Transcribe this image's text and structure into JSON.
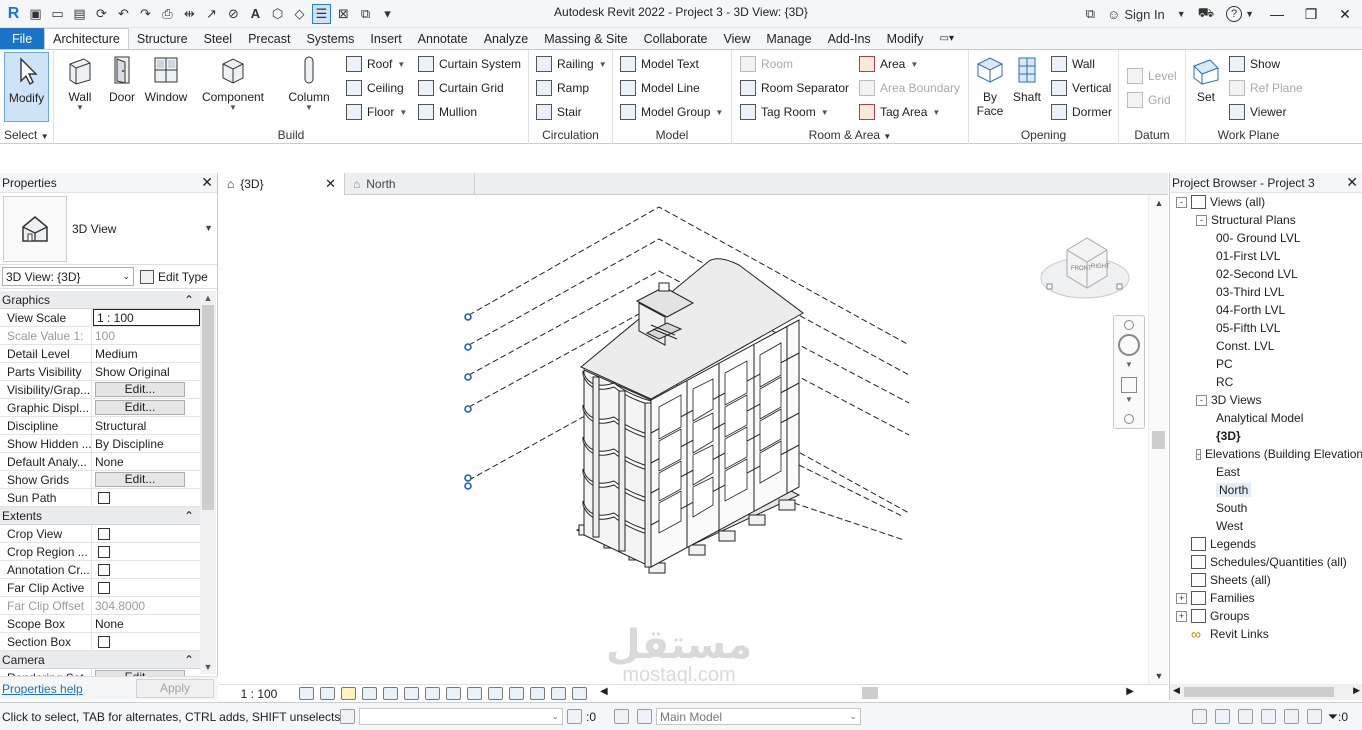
{
  "window": {
    "title": "Autodesk Revit 2022 - Project 3 - 3D View: {3D}",
    "sign_in": "Sign In",
    "help_icon": "?"
  },
  "tabs": [
    "File",
    "Architecture",
    "Structure",
    "Steel",
    "Precast",
    "Systems",
    "Insert",
    "Annotate",
    "Analyze",
    "Massing & Site",
    "Collaborate",
    "View",
    "Manage",
    "Add-Ins",
    "Modify"
  ],
  "active_tab": "Architecture",
  "ribbon": {
    "select": {
      "modify": "Modify",
      "label": "Select"
    },
    "build": {
      "label": "Build",
      "big": [
        "Wall",
        "Door",
        "Window",
        "Component",
        "Column"
      ],
      "small": [
        "Roof",
        "Ceiling",
        "Floor",
        "Curtain System",
        "Curtain Grid",
        "Mullion"
      ]
    },
    "circulation": {
      "label": "Circulation",
      "items": [
        "Railing",
        "Ramp",
        "Stair"
      ]
    },
    "model": {
      "label": "Model",
      "items": [
        "Model Text",
        "Model Line",
        "Model Group"
      ]
    },
    "room_area": {
      "label": "Room & Area",
      "items": [
        "Room",
        "Room Separator",
        "Tag Room",
        "Area",
        "Area Boundary",
        "Tag Area"
      ]
    },
    "opening": {
      "label": "Opening",
      "big": [
        "By Face",
        "Shaft"
      ],
      "items": [
        "Wall",
        "Vertical",
        "Dormer"
      ]
    },
    "datum": {
      "label": "Datum",
      "items": [
        "Level",
        "Grid"
      ]
    },
    "work_plane": {
      "label": "Work Plane",
      "set": "Set",
      "items": [
        "Show",
        "Ref  Plane",
        "Viewer"
      ]
    }
  },
  "properties": {
    "title": "Properties",
    "type_name": "3D View",
    "instance": "3D View: {3D}",
    "edit_type": "Edit Type",
    "sections": [
      {
        "name": "Graphics",
        "rows": [
          {
            "k": "View Scale",
            "v": "1 : 100",
            "style": "boxed"
          },
          {
            "k": "Scale Value    1:",
            "v": "100",
            "style": "gray"
          },
          {
            "k": "Detail Level",
            "v": "Medium"
          },
          {
            "k": "Parts Visibility",
            "v": "Show Original"
          },
          {
            "k": "Visibility/Grap...",
            "v": "Edit...",
            "style": "button"
          },
          {
            "k": "Graphic Displ...",
            "v": "Edit...",
            "style": "button"
          },
          {
            "k": "Discipline",
            "v": "Structural"
          },
          {
            "k": "Show Hidden ...",
            "v": "By Discipline"
          },
          {
            "k": "Default Analy...",
            "v": "None"
          },
          {
            "k": "Show Grids",
            "v": "Edit...",
            "style": "button"
          },
          {
            "k": "Sun Path",
            "v": "",
            "style": "check"
          }
        ]
      },
      {
        "name": "Extents",
        "rows": [
          {
            "k": "Crop View",
            "v": "",
            "style": "check"
          },
          {
            "k": "Crop Region ...",
            "v": "",
            "style": "check"
          },
          {
            "k": "Annotation Cr...",
            "v": "",
            "style": "check"
          },
          {
            "k": "Far Clip Active",
            "v": "",
            "style": "check"
          },
          {
            "k": "Far Clip Offset",
            "v": "304.8000",
            "style": "gray"
          },
          {
            "k": "Scope Box",
            "v": "None"
          },
          {
            "k": "Section Box",
            "v": "",
            "style": "check"
          }
        ]
      },
      {
        "name": "Camera",
        "rows": [
          {
            "k": "Rendering Set...",
            "v": "Edit...",
            "style": "button"
          }
        ]
      }
    ],
    "help": "Properties help",
    "apply": "Apply"
  },
  "view_tabs": [
    {
      "label": "{3D}",
      "active": true
    },
    {
      "label": "North",
      "active": false
    }
  ],
  "view_cube": {
    "front": "FRONT",
    "right": "RIGHT"
  },
  "view_scale": "1 : 100",
  "browser": {
    "title": "Project Browser - Project 3",
    "nodes": [
      {
        "label": "Views (all)",
        "depth": 0,
        "toggle": "-",
        "icon": true
      },
      {
        "label": "Structural Plans",
        "depth": 1,
        "toggle": "-"
      },
      {
        "label": "00- Ground LVL",
        "depth": 2
      },
      {
        "label": "01-First LVL",
        "depth": 2
      },
      {
        "label": "02-Second LVL",
        "depth": 2
      },
      {
        "label": "03-Third LVL",
        "depth": 2
      },
      {
        "label": "04-Forth LVL",
        "depth": 2
      },
      {
        "label": "05-Fifth LVL",
        "depth": 2
      },
      {
        "label": "Const. LVL",
        "depth": 2
      },
      {
        "label": "PC",
        "depth": 2
      },
      {
        "label": "RC",
        "depth": 2
      },
      {
        "label": "3D Views",
        "depth": 1,
        "toggle": "-"
      },
      {
        "label": "Analytical Model",
        "depth": 2
      },
      {
        "label": "{3D}",
        "depth": 2,
        "bold": true
      },
      {
        "label": "Elevations (Building Elevation)",
        "depth": 1,
        "toggle": "-"
      },
      {
        "label": "East",
        "depth": 2
      },
      {
        "label": "North",
        "depth": 2,
        "selected": true
      },
      {
        "label": "South",
        "depth": 2
      },
      {
        "label": "West",
        "depth": 2
      },
      {
        "label": "Legends",
        "depth": 0,
        "icon": true
      },
      {
        "label": "Schedules/Quantities (all)",
        "depth": 0,
        "icon": true
      },
      {
        "label": "Sheets (all)",
        "depth": 0,
        "icon": true
      },
      {
        "label": "Families",
        "depth": 0,
        "toggle": "+",
        "icon": true
      },
      {
        "label": "Groups",
        "depth": 0,
        "toggle": "+",
        "icon": true
      },
      {
        "label": "Revit Links",
        "depth": 0,
        "icon": true,
        "link": true
      }
    ]
  },
  "status": {
    "message": "Click to select, TAB for alternates, CTRL adds, SHIFT unselects.",
    "zero1": ":0",
    "model": "Main Model",
    "zero2": ":0"
  },
  "watermark": {
    "arabic": "مستقل",
    "latin": "mostaql.com"
  }
}
